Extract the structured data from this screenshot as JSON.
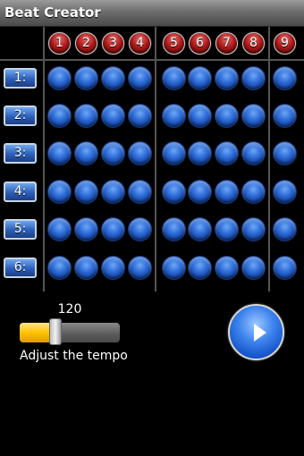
{
  "app": {
    "title": "Beat Creator"
  },
  "steps": [
    "1",
    "2",
    "3",
    "4",
    "5",
    "6",
    "7",
    "8",
    "9"
  ],
  "rows": [
    "1:",
    "2:",
    "3:",
    "4:",
    "5:",
    "6:"
  ],
  "tempo": {
    "value": "120",
    "label": "Adjust the tempo",
    "level": 0.3
  },
  "colors": {
    "accent_step": "#b21a1a",
    "pad": "#2d6bd8",
    "slider_fill": "#ffc200"
  },
  "icons": {
    "play": "play-icon"
  }
}
